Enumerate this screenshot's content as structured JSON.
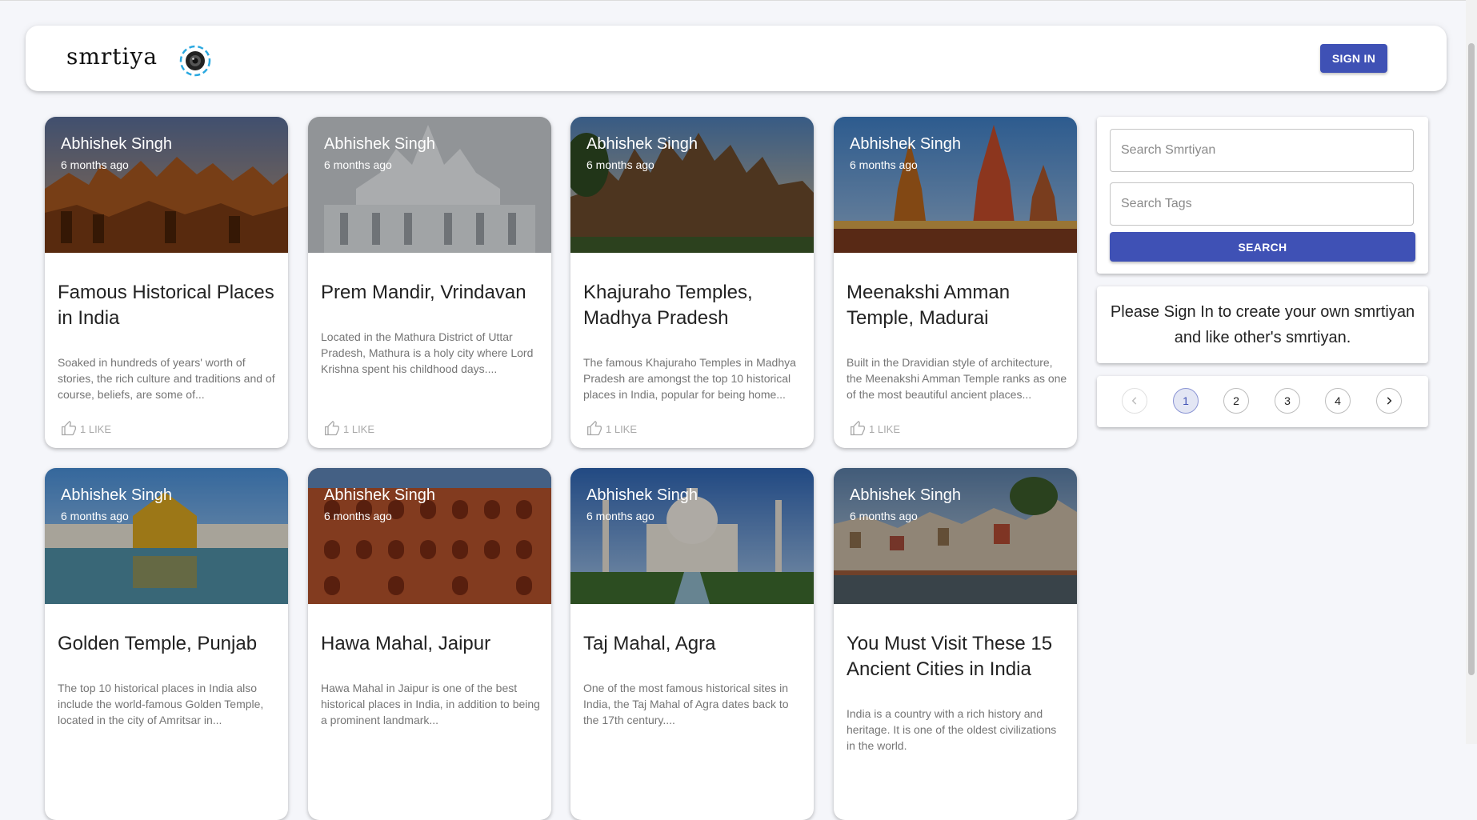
{
  "header": {
    "brand": "smrtiya",
    "signin_label": "SIGN IN"
  },
  "cards": [
    {
      "author": "Abhishek Singh",
      "time": "6 months ago",
      "title": "Famous Historical Places in India",
      "message": "Soaked in hundreds of years' worth of stories, the rich culture and traditions and of course, beliefs, are some of...",
      "likes": "1 LIKE"
    },
    {
      "author": "Abhishek Singh",
      "time": "6 months ago",
      "title": "Prem Mandir, Vrindavan",
      "message": "Located in the Mathura District of Uttar Pradesh, Mathura is a holy city where Lord Krishna spent his childhood days....",
      "likes": "1 LIKE"
    },
    {
      "author": "Abhishek Singh",
      "time": "6 months ago",
      "title": "Khajuraho Temples, Madhya Pradesh",
      "message": "The famous Khajuraho Temples in Madhya Pradesh are amongst the top 10 historical places in India, popular for being home...",
      "likes": "1 LIKE"
    },
    {
      "author": "Abhishek Singh",
      "time": "6 months ago",
      "title": "Meenakshi Amman Temple, Madurai",
      "message": "Built in the Dravidian style of architecture, the Meenakshi Amman Temple ranks as one of the most beautiful ancient places...",
      "likes": "1 LIKE"
    },
    {
      "author": "Abhishek Singh",
      "time": "6 months ago",
      "title": "Golden Temple, Punjab",
      "message": "The top 10 historical places in India also include the world-famous Golden Temple, located in the city of Amritsar in..."
    },
    {
      "author": "Abhishek Singh",
      "time": "6 months ago",
      "title": "Hawa Mahal, Jaipur",
      "message": "Hawa Mahal in Jaipur is one of the best historical places in India, in addition to being a prominent landmark..."
    },
    {
      "author": "Abhishek Singh",
      "time": "6 months ago",
      "title": "Taj Mahal, Agra",
      "message": "One of the most famous historical sites in India, the Taj Mahal of Agra dates back to the 17th century...."
    },
    {
      "author": "Abhishek Singh",
      "time": "6 months ago",
      "title": "You Must Visit These 15 Ancient Cities in India",
      "message": "India is a country with a rich history and heritage. It is one of the oldest civilizations in the world."
    }
  ],
  "search": {
    "memories_placeholder": "Search Smrtiyan",
    "tags_placeholder": "Search Tags",
    "button_label": "SEARCH"
  },
  "signin_note": "Please Sign In to create your own smrtiyan and like other's smrtiyan.",
  "pagination": {
    "pages": [
      "1",
      "2",
      "3",
      "4"
    ],
    "current": "1"
  },
  "colors": {
    "primary": "#3f51b5",
    "background": "#f5f6fa"
  }
}
